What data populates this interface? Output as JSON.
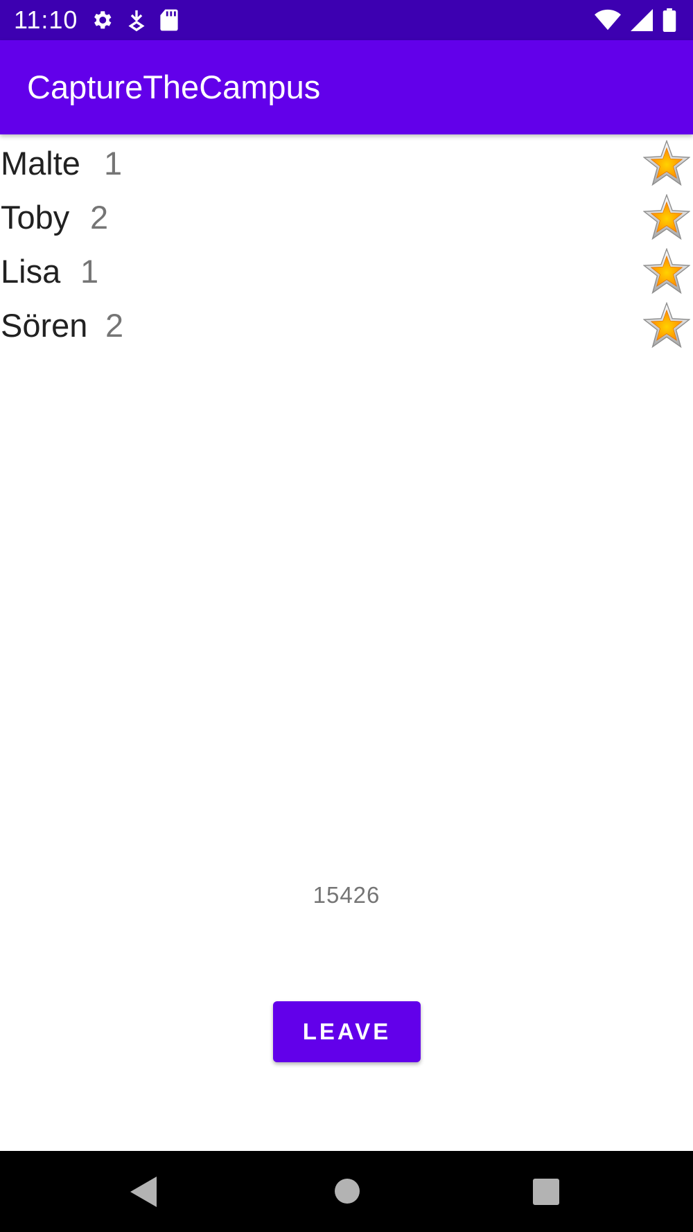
{
  "status_bar": {
    "time": "11:10",
    "icons_left": [
      "settings-icon",
      "download-icon",
      "sd-card-icon"
    ],
    "icons_right": [
      "wifi-icon",
      "signal-icon",
      "battery-icon"
    ],
    "color": "#3d00b1"
  },
  "app_bar": {
    "title": "CaptureTheCampus",
    "color": "#6200ea"
  },
  "players": [
    {
      "name": "Malte",
      "score": "1",
      "icon": "star-icon"
    },
    {
      "name": "Toby",
      "score": "2",
      "icon": "star-icon"
    },
    {
      "name": "Lisa",
      "score": "1",
      "icon": "star-icon"
    },
    {
      "name": "Sören",
      "score": "2",
      "icon": "star-icon"
    }
  ],
  "game_code": "15426",
  "leave_button": {
    "label": "LEAVE",
    "color": "#6200ea"
  },
  "nav_bar": {
    "icons": [
      "back-icon",
      "home-icon",
      "recents-icon"
    ]
  }
}
